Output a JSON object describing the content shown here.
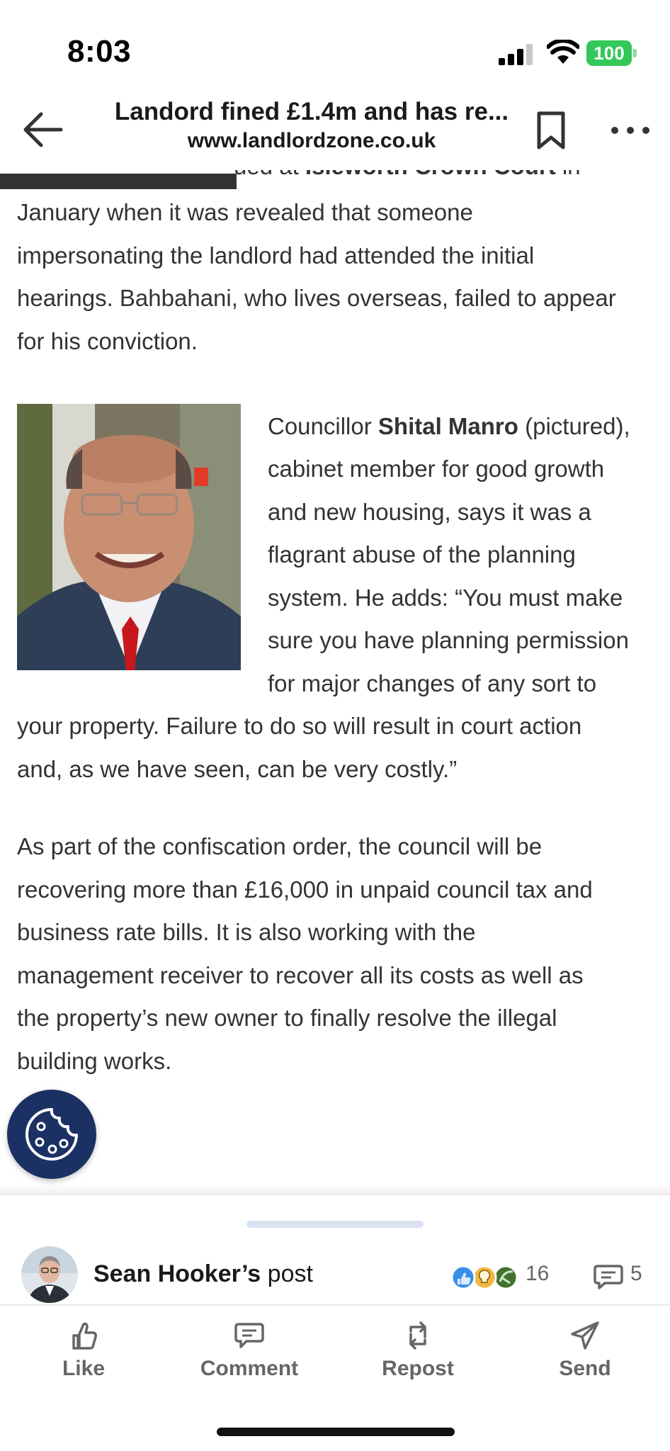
{
  "status_bar": {
    "time": "8:03",
    "battery": "100",
    "icons": [
      "cellular-signal-icon",
      "wifi-icon",
      "battery-icon"
    ]
  },
  "header": {
    "title": "Landord fined £1.4m and has re...",
    "url": "www.landlordzone.co.uk",
    "icons": [
      "back-arrow-icon",
      "bookmark-icon",
      "more-options-icon"
    ]
  },
  "article": {
    "cut_line_prefix": "ued at ",
    "cut_line_bold": "Isleworth Crown Court",
    "cut_line_suffix": " in",
    "para1_lines": [
      "January when it was revealed that someone",
      "impersonating the landlord had attended the initial",
      "hearings. Bahbahani, who lives overseas, failed to appear",
      "for his conviction."
    ],
    "para2": {
      "first_prefix": "Councillor ",
      "first_bold": "Shital Manro",
      "first_suffix": " (pictured),",
      "wrapped_lines": [
        "cabinet member for good growth",
        "and new housing, says it was a",
        "flagrant abuse of the planning",
        "system. He adds: “You must make",
        "sure you have planning permission",
        "for major changes of any sort to"
      ],
      "full_lines": [
        "your property. Failure to do so will result in court action",
        "and, as we have seen, can be very costly.”"
      ]
    },
    "para3_lines": [
      "As part of the confiscation order, the council will be",
      "recovering more than £16,000 in unpaid council tax and",
      "business rate bills. It is also working with the",
      "management receiver to recover all its costs as well as",
      "the property’s new owner to finally resolve the illegal",
      "building works."
    ]
  },
  "post_sheet": {
    "author_name": "Sean Hooker’s",
    "post_word": " post",
    "reaction_count": "16",
    "comment_count": "5",
    "actions": {
      "like": "Like",
      "comment": "Comment",
      "repost": "Repost",
      "send": "Send"
    }
  },
  "colors": {
    "battery": "#34c759",
    "cookie_button": "#1b3163",
    "text": "#333333",
    "action_grey": "#666666"
  }
}
